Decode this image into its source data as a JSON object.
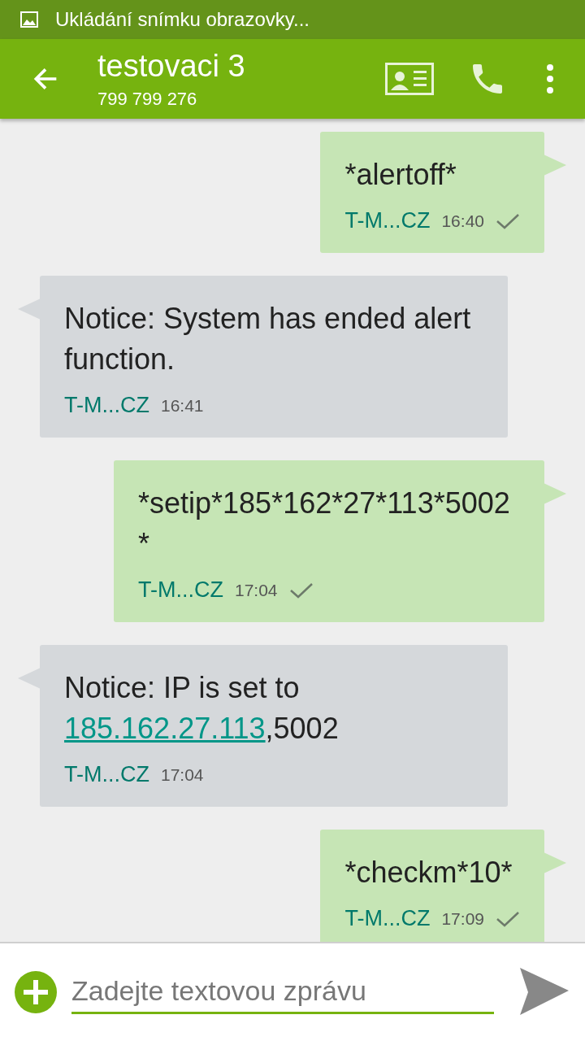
{
  "status_bar": {
    "notification": "Ukládání snímku obrazovky..."
  },
  "app_bar": {
    "title": "testovaci 3",
    "subtitle": "799 799 276"
  },
  "messages": [
    {
      "kind": "sent",
      "text": "*alertoff*",
      "sender": "T-M...CZ",
      "time": "16:40",
      "delivered": true
    },
    {
      "kind": "received",
      "text": "Notice: System has ended alert function.",
      "sender": "T-M...CZ",
      "time": "16:41",
      "delivered": false
    },
    {
      "kind": "sent",
      "text": "*setip*185*162*27*113*5002*",
      "sender": "T-M...CZ",
      "time": "17:04",
      "delivered": true
    },
    {
      "kind": "received",
      "text": "Notice: IP is set to",
      "link": "185.162.27.113",
      "suffix": ",5002",
      "sender": "T-M...CZ",
      "time": "17:04",
      "delivered": false
    },
    {
      "kind": "sent",
      "text": "*checkm*10*",
      "sender": "T-M...CZ",
      "time": "17:09",
      "delivered": true
    }
  ],
  "composer": {
    "placeholder": "Zadejte textovou zprávu"
  }
}
